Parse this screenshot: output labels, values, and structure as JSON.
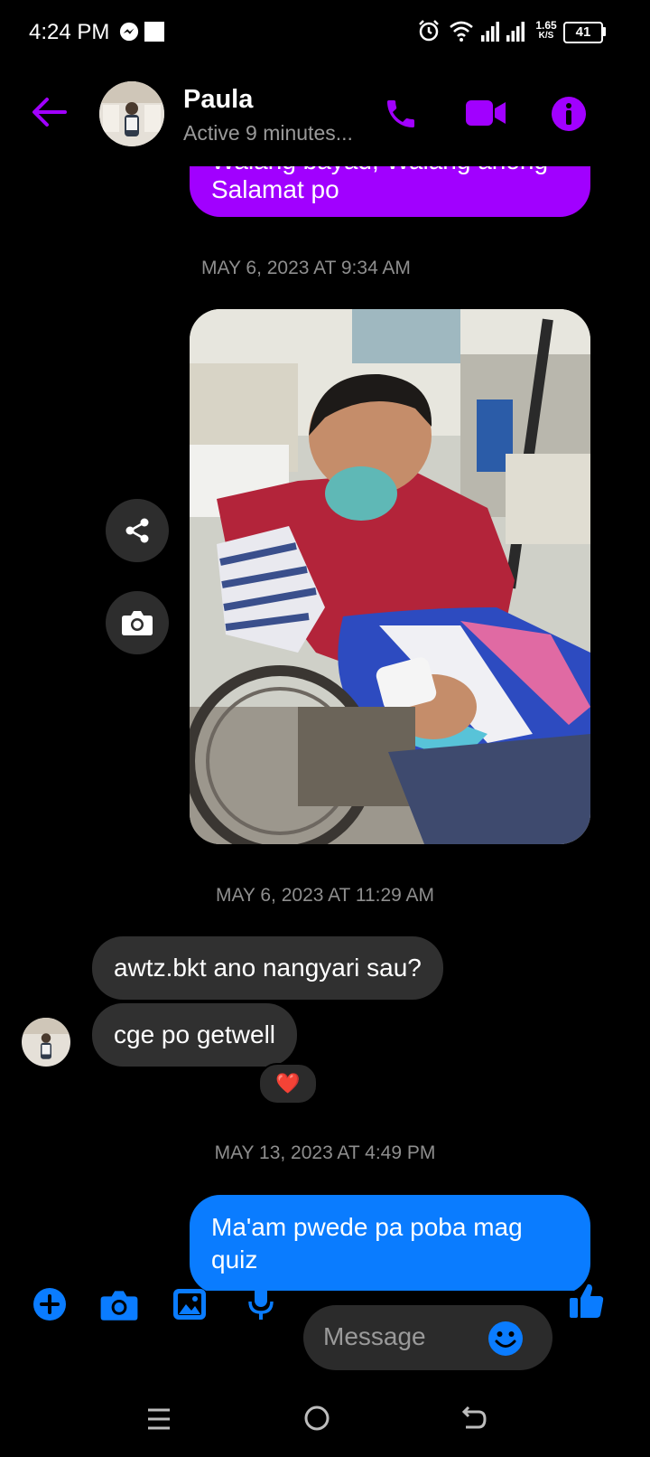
{
  "status_bar": {
    "time": "4:24 PM",
    "speed_value": "1.65",
    "speed_unit": "K/S",
    "battery": "41"
  },
  "header": {
    "contact_name": "Paula",
    "presence": "Active 9 minutes..."
  },
  "messages": {
    "top_partial_line": "Walang bayad, Walang anong",
    "top_bubble_text": "Salamat po",
    "timestamp_1": "MAY 6, 2023 AT 9:34 AM",
    "timestamp_2": "MAY 6, 2023 AT 11:29 AM",
    "incoming_1": "awtz.bkt ano nangyari sau?",
    "incoming_2": "cge po getwell",
    "reaction": "❤️",
    "timestamp_3": "MAY 13, 2023 AT 4:49 PM",
    "outgoing_last": "Ma'am pwede pa poba mag",
    "outgoing_last_partial": "quiz"
  },
  "composer": {
    "placeholder": "Message"
  },
  "colors": {
    "accent_purple": "#a100ff",
    "accent_blue": "#0a7cff",
    "incoming_bubble": "#303030"
  }
}
